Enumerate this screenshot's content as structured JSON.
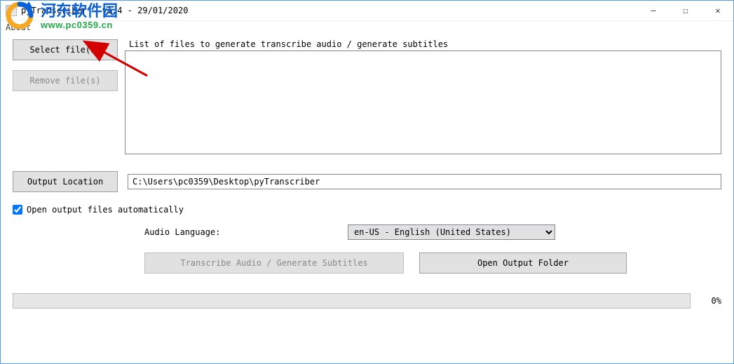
{
  "window": {
    "title": "pyTranscriber - v1.4 - 29/01/2020",
    "minimize": "—",
    "maximize": "☐",
    "close": "✕"
  },
  "menu": {
    "about": "About"
  },
  "buttons": {
    "select_files": "Select file(s)",
    "remove_files": "Remove file(s)",
    "output_location": "Output Location",
    "transcribe": "Transcribe Audio / Generate Subtitles",
    "open_output": "Open Output Folder"
  },
  "labels": {
    "file_list": "List of files to generate transcribe audio / generate subtitles",
    "open_auto": "Open output files automatically",
    "audio_language": "Audio Language:"
  },
  "fields": {
    "output_path": "C:\\Users\\pc0359\\Desktop\\pyTranscriber",
    "language_selected": "en-US - English (United States)"
  },
  "progress": {
    "percent": "0%"
  },
  "watermark": {
    "cn": "河东软件园",
    "url": "www.pc0359.cn"
  }
}
